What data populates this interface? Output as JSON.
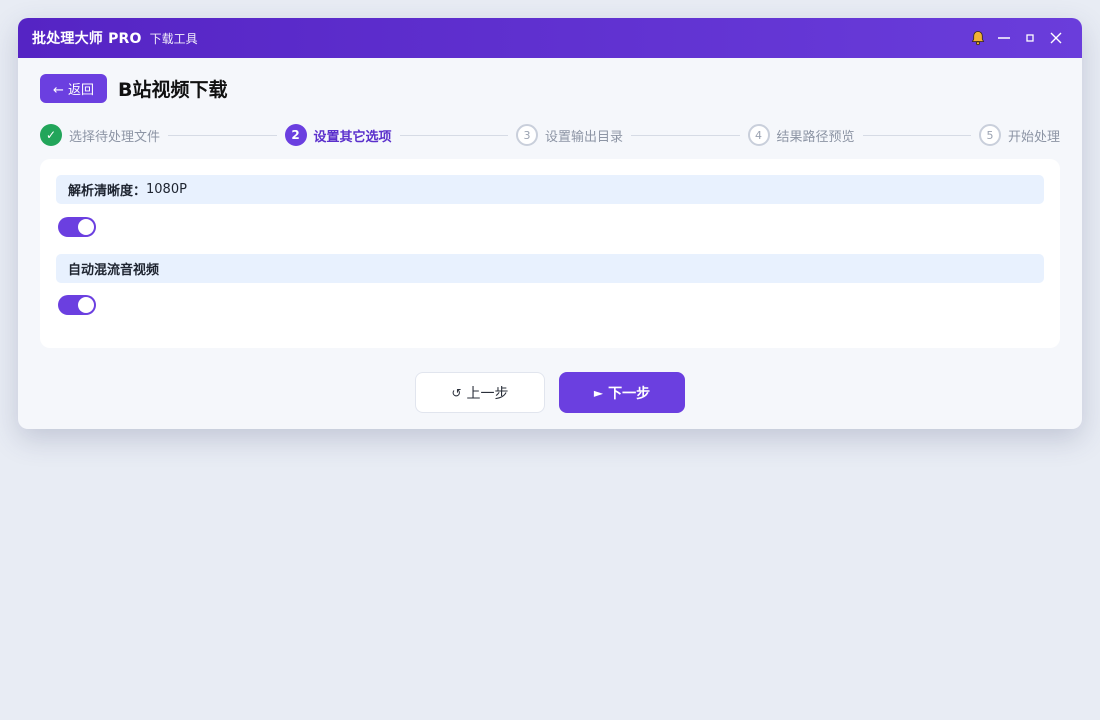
{
  "window": {
    "app_title": "批处理大师 PRO",
    "app_subtitle": "下载工具",
    "controls": {
      "bell_icon": "bell-icon",
      "minimize_icon": "minimize-icon",
      "maximize_icon": "maximize-icon",
      "close_icon": "close-icon"
    }
  },
  "header": {
    "back_label": "← 返回",
    "page_title": "B站视频下载"
  },
  "stepper": {
    "steps": [
      {
        "number": "✓",
        "label": "选择待处理文件",
        "state": "done"
      },
      {
        "number": "2",
        "label": "设置其它选项",
        "state": "active"
      },
      {
        "number": "3",
        "label": "设置输出目录",
        "state": "pending"
      },
      {
        "number": "4",
        "label": "结果路径预览",
        "state": "pending"
      },
      {
        "number": "5",
        "label": "开始处理",
        "state": "pending"
      }
    ]
  },
  "options": [
    {
      "label": "解析清晰度：",
      "value": "1080P",
      "toggle_on": true
    },
    {
      "label": "自动混流音视频",
      "value": "",
      "toggle_on": true
    }
  ],
  "footer": {
    "prev_icon": "↺",
    "prev_label": "上一步",
    "next_icon": "►",
    "next_label": "下一步"
  },
  "colors": {
    "accent": "#6b3fe0",
    "title_gradient_start": "#5524c4",
    "title_gradient_end": "#6a3ddb",
    "done": "#22a55a",
    "option_header_bg": "#e8f1fe",
    "bell": "#f2b233"
  }
}
